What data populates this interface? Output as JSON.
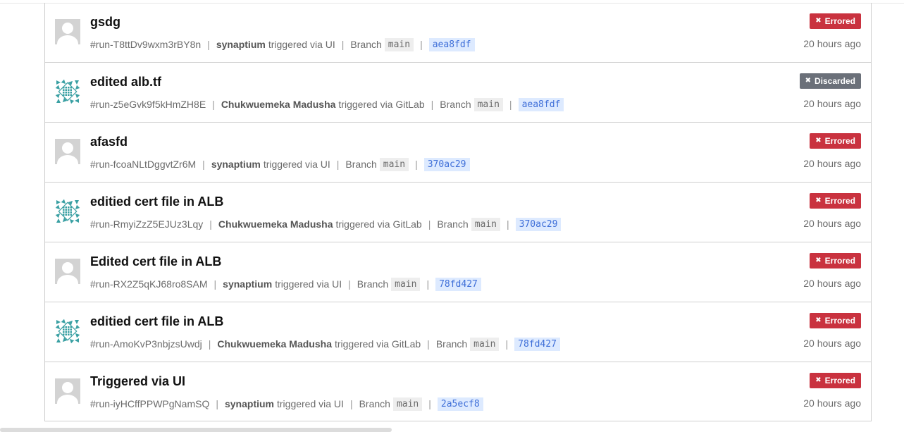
{
  "runs": [
    {
      "title": "gsdg",
      "run_id": "#run-T8ttDv9wxm3rBY8n",
      "user": "synaptium",
      "trigger": "triggered via UI",
      "branch_label": "Branch",
      "branch": "main",
      "commit": "aea8fdf",
      "status": "Errored",
      "status_color": "#c9323f",
      "time": "20 hours ago",
      "avatar": "default-avatar-icon"
    },
    {
      "title": "edited alb.tf",
      "run_id": "#run-z5eGvk9f5kHmZH8E",
      "user": "Chukwuemeka Madusha",
      "trigger": "triggered via GitLab",
      "branch_label": "Branch",
      "branch": "main",
      "commit": "aea8fdf",
      "status": "Discarded",
      "status_color": "#6b7079",
      "time": "20 hours ago",
      "avatar": "identicon-avatar-icon"
    },
    {
      "title": "afasfd",
      "run_id": "#run-fcoaNLtDggvtZr6M",
      "user": "synaptium",
      "trigger": "triggered via UI",
      "branch_label": "Branch",
      "branch": "main",
      "commit": "370ac29",
      "status": "Errored",
      "status_color": "#c9323f",
      "time": "20 hours ago",
      "avatar": "default-avatar-icon"
    },
    {
      "title": "editied cert file in ALB",
      "run_id": "#run-RmyiZzZ5EJUz3Lqy",
      "user": "Chukwuemeka Madusha",
      "trigger": "triggered via GitLab",
      "branch_label": "Branch",
      "branch": "main",
      "commit": "370ac29",
      "status": "Errored",
      "status_color": "#c9323f",
      "time": "20 hours ago",
      "avatar": "identicon-avatar-icon"
    },
    {
      "title": "Edited cert file in ALB",
      "run_id": "#run-RX2Z5qKJ68ro8SAM",
      "user": "synaptium",
      "trigger": "triggered via UI",
      "branch_label": "Branch",
      "branch": "main",
      "commit": "78fd427",
      "status": "Errored",
      "status_color": "#c9323f",
      "time": "20 hours ago",
      "avatar": "default-avatar-icon"
    },
    {
      "title": "editied cert file in ALB",
      "run_id": "#run-AmoKvP3nbjzsUwdj",
      "user": "Chukwuemeka Madusha",
      "trigger": "triggered via GitLab",
      "branch_label": "Branch",
      "branch": "main",
      "commit": "78fd427",
      "status": "Errored",
      "status_color": "#c9323f",
      "time": "20 hours ago",
      "avatar": "identicon-avatar-icon"
    },
    {
      "title": "Triggered via UI",
      "run_id": "#run-iyHCffPPWPgNamSQ",
      "user": "synaptium",
      "trigger": "triggered via UI",
      "branch_label": "Branch",
      "branch": "main",
      "commit": "2a5ecf8",
      "status": "Errored",
      "status_color": "#c9323f",
      "time": "20 hours ago",
      "avatar": "default-avatar-icon"
    }
  ],
  "icons": {
    "status": "x-icon",
    "separator": "|"
  }
}
